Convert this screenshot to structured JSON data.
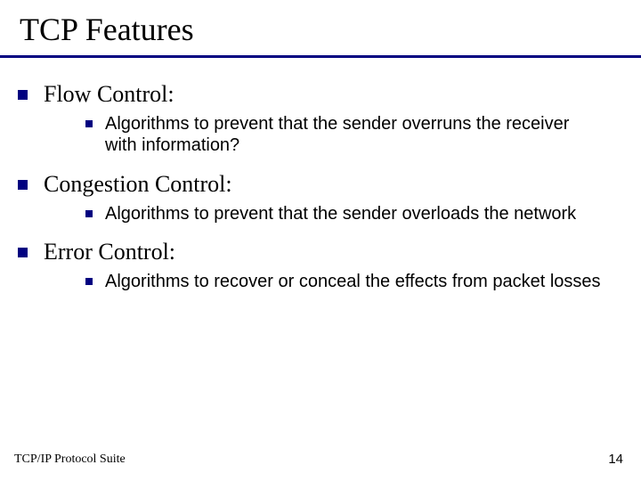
{
  "title": "TCP Features",
  "items": [
    {
      "heading": "Flow Control:",
      "sub": "Algorithms to prevent that the sender overruns the receiver with information?"
    },
    {
      "heading": "Congestion Control:",
      "sub": "Algorithms to prevent that the sender overloads the network"
    },
    {
      "heading": "Error Control:",
      "sub": "Algorithms to recover or conceal the effects from packet losses"
    }
  ],
  "footer": {
    "left": "TCP/IP Protocol Suite",
    "right": "14"
  }
}
